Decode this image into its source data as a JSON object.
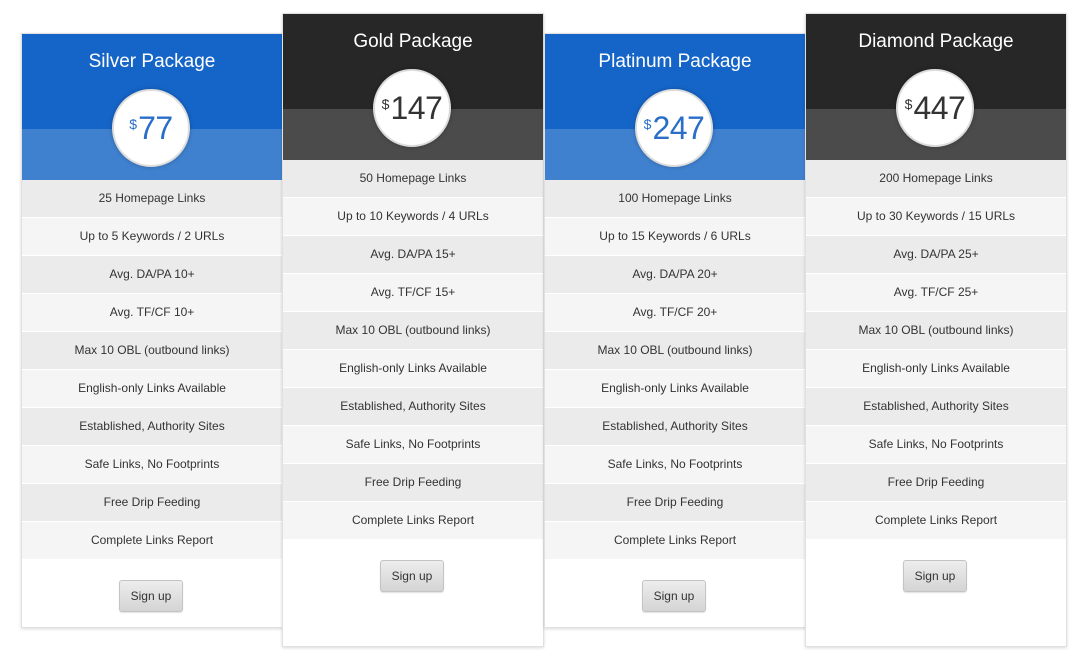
{
  "plans": [
    {
      "name": "Silver Package",
      "currency": "$",
      "price": "77",
      "theme": "blue",
      "features": [
        "25 Homepage Links",
        "Up to 5 Keywords / 2 URLs",
        "Avg. DA/PA 10+",
        "Avg. TF/CF 10+",
        "Max 10 OBL (outbound links)",
        "English-only Links Available",
        "Established, Authority Sites",
        "Safe Links, No Footprints",
        "Free Drip Feeding",
        "Complete Links Report"
      ],
      "button": "Sign up"
    },
    {
      "name": "Gold Package",
      "currency": "$",
      "price": "147",
      "theme": "dark",
      "features": [
        "50 Homepage Links",
        "Up to 10 Keywords / 4 URLs",
        "Avg. DA/PA 15+",
        "Avg. TF/CF 15+",
        "Max 10 OBL (outbound links)",
        "English-only Links Available",
        "Established, Authority Sites",
        "Safe Links, No Footprints",
        "Free Drip Feeding",
        "Complete Links Report"
      ],
      "button": "Sign up"
    },
    {
      "name": "Platinum Package",
      "currency": "$",
      "price": "247",
      "theme": "blue",
      "features": [
        "100 Homepage Links",
        "Up to 15 Keywords / 6 URLs",
        "Avg. DA/PA 20+",
        "Avg. TF/CF 20+",
        "Max 10 OBL (outbound links)",
        "English-only Links Available",
        "Established, Authority Sites",
        "Safe Links, No Footprints",
        "Free Drip Feeding",
        "Complete Links Report"
      ],
      "button": "Sign up"
    },
    {
      "name": "Diamond Package",
      "currency": "$",
      "price": "447",
      "theme": "dark",
      "features": [
        "200 Homepage Links",
        "Up to 30 Keywords / 15 URLs",
        "Avg. DA/PA 25+",
        "Avg. TF/CF 25+",
        "Max 10 OBL (outbound links)",
        "English-only Links Available",
        "Established, Authority Sites",
        "Safe Links, No Footprints",
        "Free Drip Feeding",
        "Complete Links Report"
      ],
      "button": "Sign up"
    }
  ],
  "colors": {
    "blue_top": "#1565c8",
    "blue_bottom": "#3f81cf",
    "dark_top": "#272727",
    "dark_bottom": "#4b4b4b",
    "blue_price_text": "#2a6ec8"
  }
}
